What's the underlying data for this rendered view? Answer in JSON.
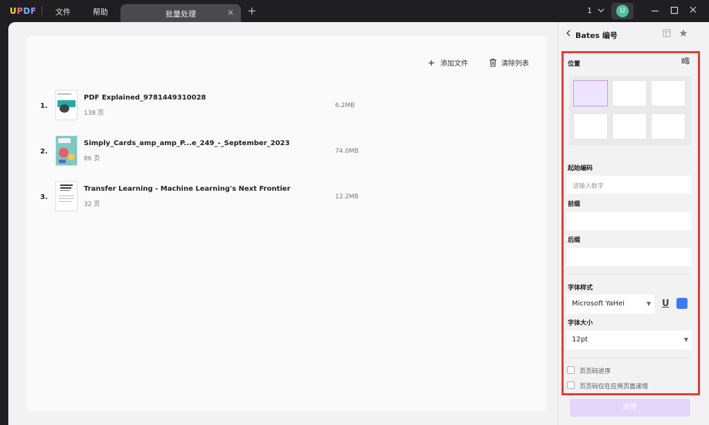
{
  "app": {
    "logo": {
      "u": "U",
      "p": "P",
      "d": "D",
      "f": "F"
    },
    "menu_file": "文件",
    "menu_help": "帮助"
  },
  "tab": {
    "label": "批量处理",
    "close": "×"
  },
  "new_tab": "+",
  "page_indicator": "1",
  "avatar_letter": "U",
  "toolbar": {
    "add_file": "添加文件",
    "clear_list": "清除列表"
  },
  "files": [
    {
      "num": "1.",
      "name": "PDF Explained_9781449310028",
      "pages": "138 页",
      "size": "6.2MB"
    },
    {
      "num": "2.",
      "name": "Simply_Cards_amp_amp_P...e_249_-_September_2023",
      "pages": "86 页",
      "size": "74.0MB"
    },
    {
      "num": "3.",
      "name": "Transfer Learning - Machine Learning's Next Frontier",
      "pages": "32 页",
      "size": "12.2MB"
    }
  ],
  "panel": {
    "title": "Bates 编号",
    "position_label": "位置",
    "start_label": "起始编码",
    "start_placeholder": "请输入数字",
    "prefix_label": "前缀",
    "suffix_label": "后缀",
    "font_style_label": "字体样式",
    "font_family_value": "Microsoft YaHei",
    "font_size_label": "字体大小",
    "font_size_value": "12pt",
    "opt_reverse": "页页码逆序",
    "opt_apply_only": "页页码仅在应用页面递增",
    "apply_button": "应用",
    "font_color": "#3d7bf5"
  }
}
